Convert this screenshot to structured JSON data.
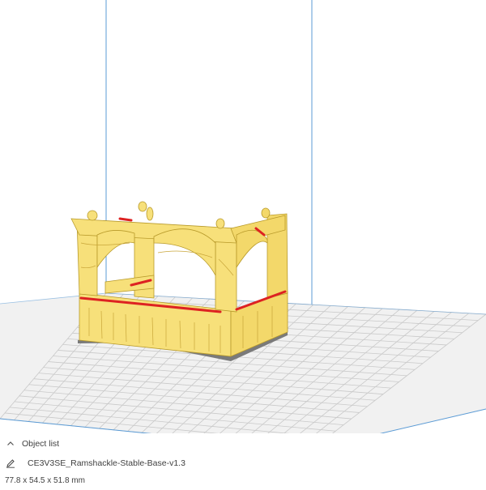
{
  "bottom_panel": {
    "object_list_label": "Object list",
    "object_name": "CE3V3SE_Ramshackle-Stable-Base-v1.3",
    "dimensions": "77.8 x 54.5 x 51.8 mm",
    "icons": [
      "chevron-up-icon",
      "pencil-icon"
    ]
  },
  "viewport": {
    "model_name": "CE3V3SE_Ramshackle-Stable-Base-v1.3",
    "colors": {
      "model_fill": "#f7e07a",
      "model_shadow": "#e6c85a",
      "overhang": "#dd2222",
      "build_plate": "#f0f0f0",
      "grid_line": "#c8c8c8",
      "volume_edge": "#5b9bd5"
    }
  }
}
